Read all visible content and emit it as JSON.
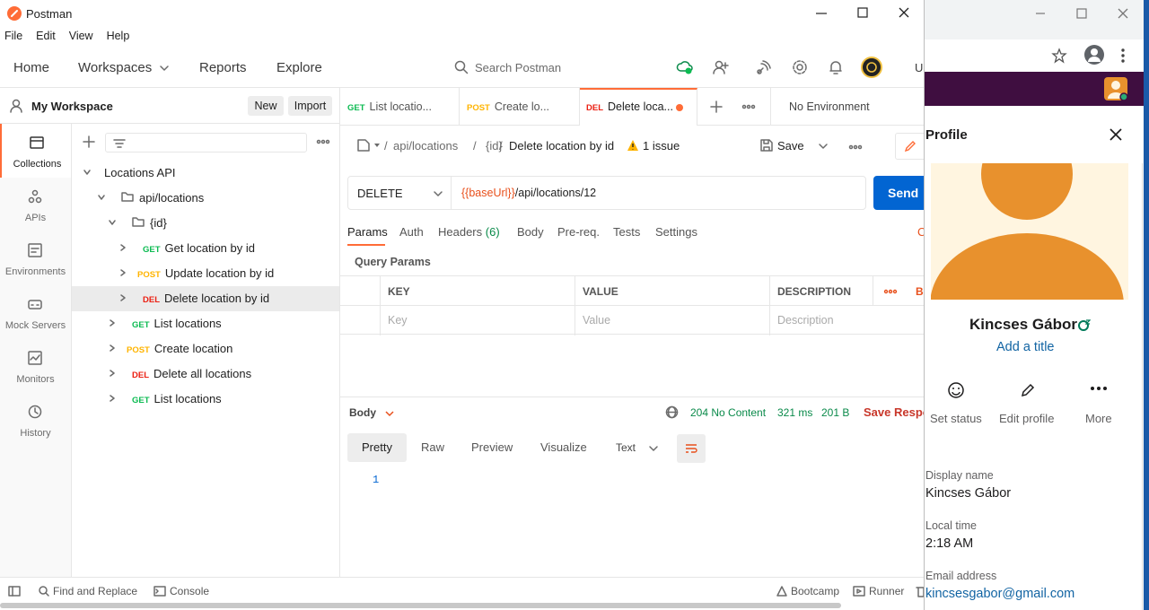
{
  "window": {
    "title": "Postman"
  },
  "menu": [
    "File",
    "Edit",
    "View",
    "Help"
  ],
  "nav": {
    "home": "Home",
    "workspaces": "Workspaces",
    "reports": "Reports",
    "explore": "Explore",
    "search_placeholder": "Search Postman",
    "upgrade_partial": "U"
  },
  "workspace": {
    "name": "My Workspace",
    "new_label": "New",
    "import_label": "Import"
  },
  "sidebar": [
    "Collections",
    "APIs",
    "Environments",
    "Mock Servers",
    "Monitors",
    "History"
  ],
  "tree": {
    "root": "Locations API",
    "folder": "api/locations",
    "subfolder": "{id}",
    "items": [
      {
        "method": "GET",
        "name": "Get location by id"
      },
      {
        "method": "POST",
        "name": "Update location by id"
      },
      {
        "method": "DEL",
        "name": "Delete location by id"
      }
    ],
    "root_items": [
      {
        "method": "GET",
        "name": "List locations"
      },
      {
        "method": "POST",
        "name": "Create location"
      },
      {
        "method": "DEL",
        "name": "Delete all locations"
      },
      {
        "method": "GET",
        "name": "List locations"
      }
    ]
  },
  "tabs": [
    {
      "method": "GET",
      "name": "List locatio..."
    },
    {
      "method": "POST",
      "name": "Create lo..."
    },
    {
      "method": "DEL",
      "name": "Delete loca..."
    }
  ],
  "environment": "No Environment",
  "request": {
    "crumbs": [
      "api/locations",
      "/",
      "{id}",
      "/"
    ],
    "title": "Delete location by id",
    "issues": "1 issue",
    "save": "Save",
    "method": "DELETE",
    "url_var": "{{baseUrl}}",
    "url_path": "/api/locations/12",
    "send": "Send"
  },
  "req_tabs": {
    "params": "Params",
    "auth": "Auth",
    "headers": "Headers",
    "headers_count": "(6)",
    "body": "Body",
    "prereq": "Pre-req.",
    "tests": "Tests",
    "settings": "Settings",
    "cookies_partial": "C"
  },
  "query": {
    "title": "Query Params",
    "cols": [
      "KEY",
      "VALUE",
      "DESCRIPTION",
      "Bu"
    ],
    "placeholders": [
      "Key",
      "Value",
      "Description"
    ]
  },
  "response": {
    "label": "Body",
    "status": "204 No Content",
    "time": "321 ms",
    "size": "201 B",
    "save": "Save Respo",
    "tabs": [
      "Pretty",
      "Raw",
      "Preview",
      "Visualize"
    ],
    "format": "Text",
    "line": "1"
  },
  "statusbar": {
    "find": "Find and Replace",
    "console": "Console",
    "bootcamp": "Bootcamp",
    "runner": "Runner"
  },
  "profile": {
    "header": "Profile",
    "name": "Kincses Gábor",
    "add_title": "Add a title",
    "actions": [
      "Set status",
      "Edit profile",
      "More"
    ],
    "display_label": "Display name",
    "display_value": "Kincses Gábor",
    "time_label": "Local time",
    "time_value": "2:18 AM",
    "email_label": "Email address",
    "email_value": "kincsesgabor@gmail.com"
  },
  "colors": {
    "orange": "#ff6c37",
    "blue": "#0265d2",
    "avatar": "#e8912d",
    "slack": "#3f0e40"
  }
}
